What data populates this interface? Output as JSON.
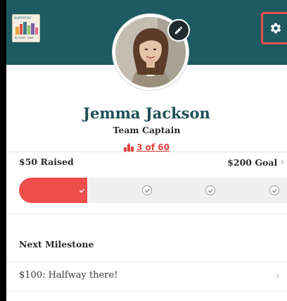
{
  "header": {
    "logo_icon": "summer-bar-chart-logo",
    "logo_text": "summer",
    "logo_subtext": "for kids' sake",
    "settings_icon": "gear-icon",
    "edit_icon": "pencil-icon",
    "brand_color": "#1d5a62",
    "highlight_color": "#e2514f"
  },
  "profile": {
    "name": "Jemma Jackson",
    "role": "Team Captain",
    "rank_icon": "podium-icon",
    "rank_text": "3 of 60"
  },
  "progress": {
    "raised_label": "$50 Raised",
    "goal_label": "$200 Goal",
    "raised_amount": 50,
    "goal_amount": 200,
    "fraction": 0.25,
    "checkpoints": [
      0.25,
      0.5,
      0.75,
      1.0
    ],
    "fill_color": "#ee4e4b"
  },
  "milestones": {
    "section_label": "Next Milestone",
    "next": "$100: Halfway there!"
  }
}
